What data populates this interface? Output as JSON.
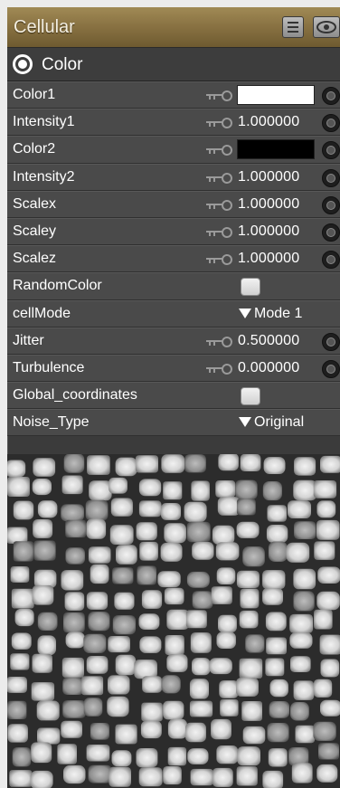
{
  "panel": {
    "title": "Cellular",
    "buttons": {
      "menu": "menu-icon",
      "visibility": "eye-icon"
    }
  },
  "section": {
    "label": "Color",
    "icon": "target-icon"
  },
  "rows": [
    {
      "label": "Color1",
      "kind": "color",
      "color": "#ffffff"
    },
    {
      "label": "Intensity1",
      "kind": "number",
      "value": "1.000000"
    },
    {
      "label": "Color2",
      "kind": "color",
      "color": "#000000"
    },
    {
      "label": "Intensity2",
      "kind": "number",
      "value": "1.000000"
    },
    {
      "label": "Scalex",
      "kind": "number",
      "value": "1.000000"
    },
    {
      "label": "Scaley",
      "kind": "number",
      "value": "1.000000"
    },
    {
      "label": "Scalez",
      "kind": "number",
      "value": "1.000000"
    },
    {
      "label": "RandomColor",
      "kind": "checkbox",
      "checked": false
    },
    {
      "label": "cellMode",
      "kind": "dropdown",
      "value": "Mode 1"
    },
    {
      "label": "Jitter",
      "kind": "number",
      "value": "0.500000"
    },
    {
      "label": "Turbulence",
      "kind": "number",
      "value": "0.000000"
    },
    {
      "label": "Global_coordinates",
      "kind": "checkbox",
      "checked": false
    },
    {
      "label": "Noise_Type",
      "kind": "dropdown",
      "value": "Original"
    }
  ],
  "preview": {
    "name": "cellular-noise-preview"
  }
}
